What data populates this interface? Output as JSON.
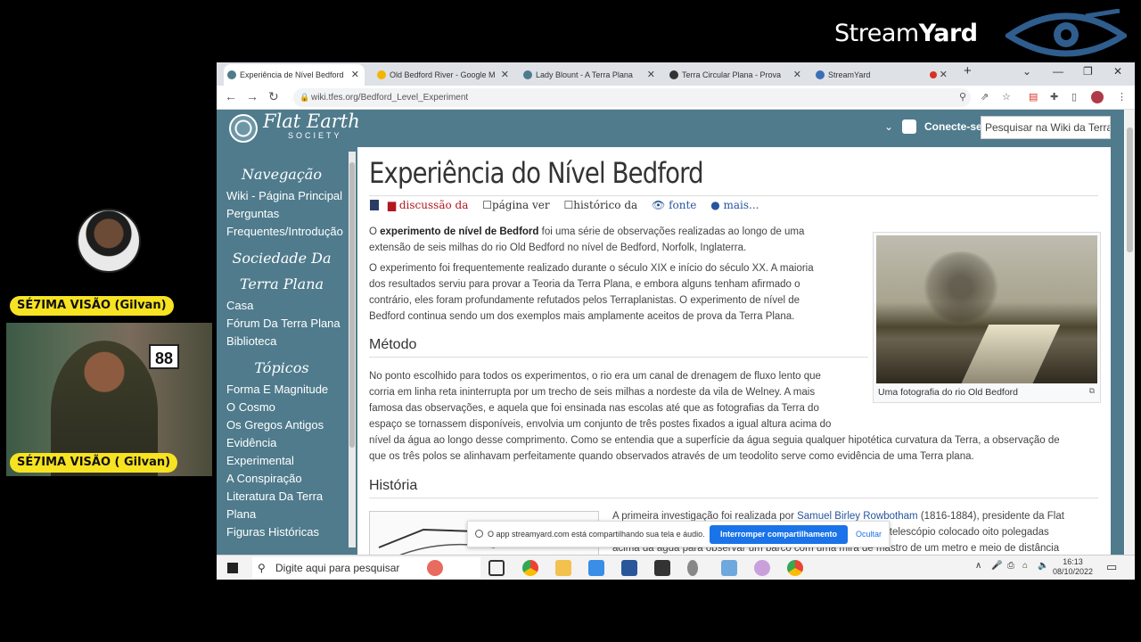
{
  "streamyard": {
    "logo_text_light": "Stream",
    "logo_text_bold": "Yard"
  },
  "participants": {
    "host_name": "SÉ7IMA VISÃO (Gilvan)",
    "camera_name": "SÉ7IMA VISÃO ( Gilvan)",
    "poster_text": "88"
  },
  "browser": {
    "tabs": [
      {
        "label": "Experiência de Nível Bedford",
        "favicon_color": "#4f7b8c",
        "active": true
      },
      {
        "label": "Old Bedford River - Google M",
        "favicon_color": "#f4b400",
        "active": false
      },
      {
        "label": "Lady Blount - A Terra Plana",
        "favicon_color": "#4f7b8c",
        "active": false
      },
      {
        "label": "Terra Circular Plana - Prova",
        "favicon_color": "#333333",
        "active": false
      },
      {
        "label": "StreamYard",
        "favicon_color": "#3b6fb6",
        "active": false
      }
    ],
    "url": "wiki.tfes.org/Bedford_Level_Experiment",
    "new_tab_icon": "+"
  },
  "site": {
    "logo_title": "Flat Earth",
    "logo_sub": "SOCIETY",
    "login_label": "Conecte-se",
    "search_placeholder": "Pesquisar na Wiki da Terra F"
  },
  "sidebar": {
    "sections": [
      {
        "heading": "Navegação",
        "links": [
          "Wiki - Página Principal",
          "Perguntas",
          "Frequentes/Introdução"
        ]
      },
      {
        "heading_line1": "Sociedade Da",
        "heading_line2": "Terra Plana",
        "links": [
          "Casa",
          "Fórum Da Terra Plana",
          "Biblioteca"
        ]
      },
      {
        "heading": "Tópicos",
        "links": [
          "Forma E Magnitude",
          "O Cosmo",
          "Os Gregos Antigos",
          "Evidência",
          "Experimental",
          "A Conspiração",
          "Literatura Da Terra",
          "Plana",
          "Figuras Históricas"
        ]
      }
    ]
  },
  "article": {
    "title": "Experiência do Nível Bedford",
    "actions": {
      "discussion": "discussão da",
      "page": "página ver",
      "history": "histórico da",
      "source": "fonte",
      "more": "mais..."
    },
    "intro_bold": "experimento de nível de Bedford",
    "intro_pre": "O ",
    "intro_post": " foi uma série de observações realizadas ao longo de uma",
    "intro_line2": "extensão de seis milhas do rio Old Bedford no nível de Bedford, Norfolk, Inglaterra.",
    "p2_lines": [
      "O experimento foi frequentemente realizado durante o século XIX e início do século XX. A maioria",
      "dos resultados serviu para provar a Teoria da Terra Plana, e embora alguns tenham afirmado o",
      "contrário, eles foram profundamente refutados pelos Terraplanistas. O experimento de nível de",
      "Bedford continua sendo um dos exemplos mais amplamente aceitos de prova da Terra Plana."
    ],
    "method_heading": "Método",
    "method_lines": [
      "No ponto escolhido para todos os experimentos, o rio era um canal de drenagem de fluxo lento que",
      "corria em linha reta ininterrupta por um trecho de seis milhas a nordeste da vila de Welney. A mais",
      "famosa das observações, e aquela que foi ensinada nas escolas até que as fotografias da Terra do",
      "espaço se tornassem disponíveis, envolvia um conjunto de três postes fixados a igual altura acima do",
      "nível da água ao longo desse comprimento. Como se entendia que a superfície da água seguia qualquer hipotética curvatura da Terra, a observação de",
      "que os três polos se alinhavam perfeitamente quando observados através de um teodolito serve como evidência de uma Terra plana."
    ],
    "history_heading": "História",
    "history_line1_pre": "A primeira investigação foi realizada por ",
    "history_link": "Samuel Birley Rowbotham",
    "history_line1_post": " (1816-1884), presidente da Flat",
    "history_line2": "u um telescópio colocado oito polegadas",
    "history_line3": "acima da água para observar um barco com uma mira de mastro de um metro e meio de distância",
    "image_caption": "Uma fotografia do rio Old Bedford"
  },
  "share_bar": {
    "message": "O app streamyard.com está compartilhando sua tela e áudio.",
    "stop_label": "Interromper compartilhamento",
    "hide_label": "Ocultar"
  },
  "taskbar": {
    "search_placeholder": "Digite aqui para pesquisar",
    "time": "16:13",
    "date": "08/10/2022"
  },
  "colors": {
    "site_teal": "#4f7b8c",
    "name_pill": "#f7e321",
    "link_blue": "#27559f",
    "action_red": "#b3171f",
    "share_button": "#1a73e8"
  }
}
